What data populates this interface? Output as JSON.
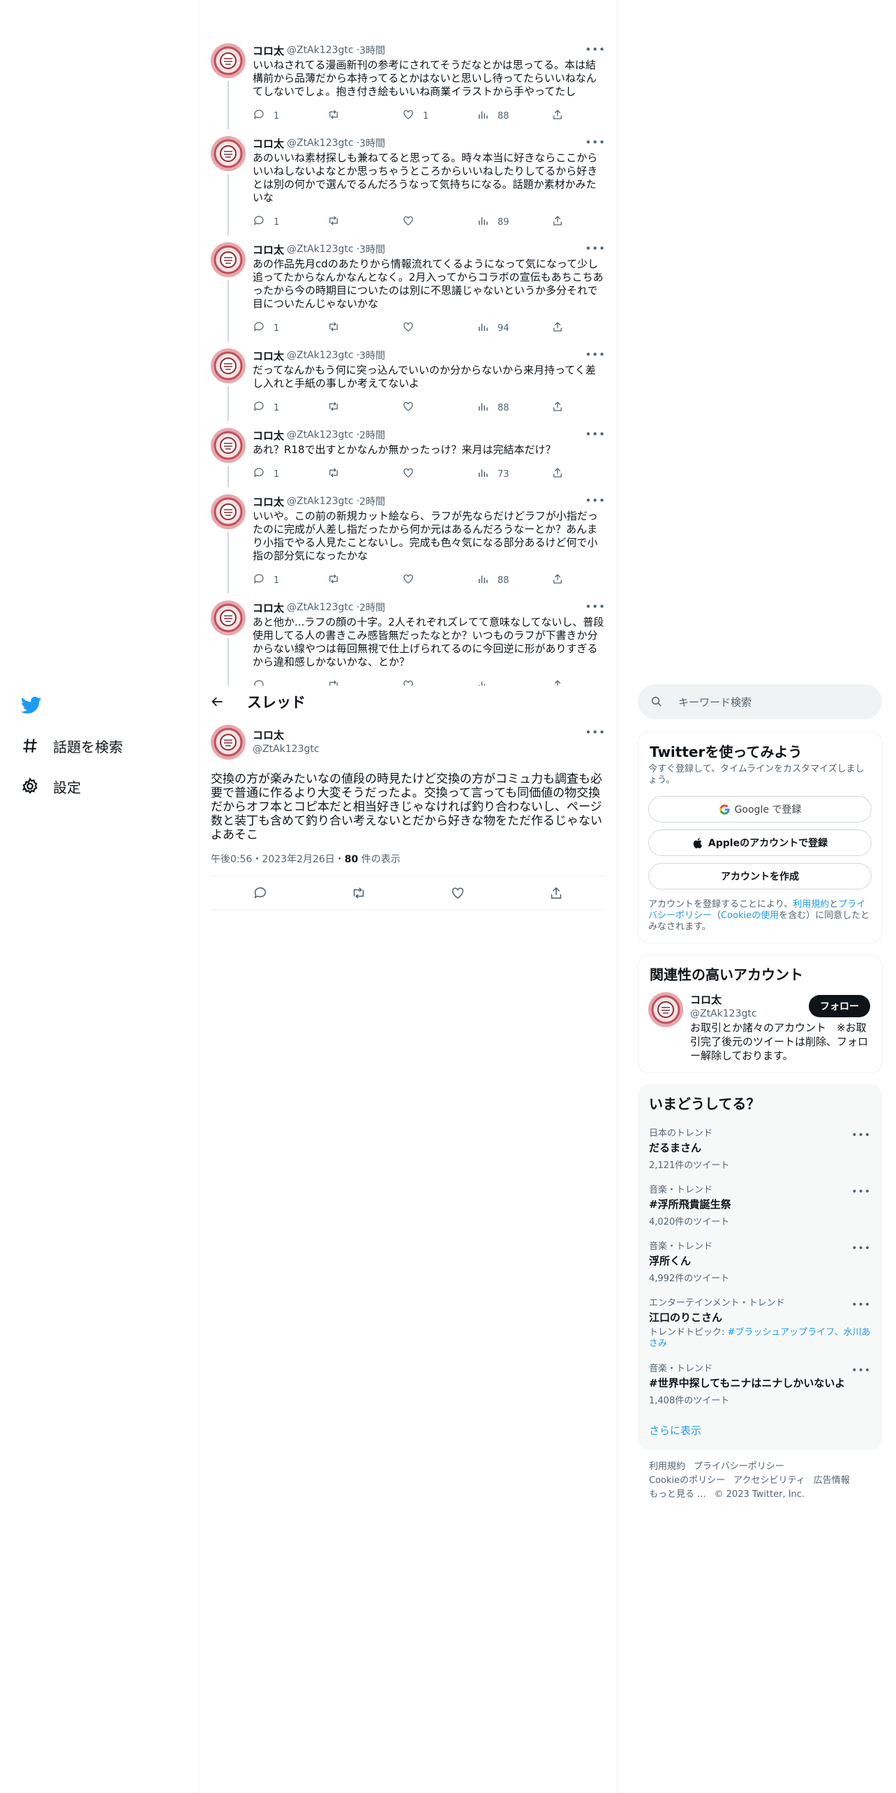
{
  "thread": [
    {
      "name": "コロ太",
      "handle": "@ZtAk123gtc",
      "time": "3時間",
      "text": "いいねされてる漫画新刊の参考にされてそうだなとかは思ってる。本は結構前から品薄だから本持ってるとかはないと思いし待ってたらいいねなんてしないでしょ。抱き付き絵もいいね商業イラストから手やってたし",
      "reply": "1",
      "retweet": "",
      "like": "1",
      "views": "88"
    },
    {
      "name": "コロ太",
      "handle": "@ZtAk123gtc",
      "time": "3時間",
      "text": "あのいいね素材探しも兼ねてると思ってる。時々本当に好きならここからいいねしないよなとか思っちゃうところからいいねしたりしてるから好きとは別の何かで選んでるんだろうなって気持ちになる。話題か素材かみたいな",
      "reply": "1",
      "retweet": "",
      "like": "",
      "views": "89"
    },
    {
      "name": "コロ太",
      "handle": "@ZtAk123gtc",
      "time": "3時間",
      "text": "あの作品先月cdのあたりから情報流れてくるようになって気になって少し追ってたからなんかなんとなく。2月入ってからコラボの宣伝もあちこちあったから今の時期目についたのは別に不思議じゃないというか多分それで目についたんじゃないかな",
      "reply": "1",
      "retweet": "",
      "like": "",
      "views": "94"
    },
    {
      "name": "コロ太",
      "handle": "@ZtAk123gtc",
      "time": "3時間",
      "text": "だってなんかもう何に突っ込んでいいのか分からないから来月持ってく差し入れと手紙の事しか考えてないよ",
      "reply": "1",
      "retweet": "",
      "like": "",
      "views": "88"
    },
    {
      "name": "コロ太",
      "handle": "@ZtAk123gtc",
      "time": "2時間",
      "text": "あれ？R18で出すとかなんか無かったっけ？来月は完結本だけ？",
      "reply": "1",
      "retweet": "",
      "like": "",
      "views": "73"
    },
    {
      "name": "コロ太",
      "handle": "@ZtAk123gtc",
      "time": "2時間",
      "text": "いいや。この前の新規カット絵なら、ラフが先ならだけどラフが小指だったのに完成が人差し指だったから何か元はあるんだろうなーとか？あんまり小指でやる人見たことないし。完成も色々気になる部分あるけど何で小指の部分気になったかな",
      "reply": "1",
      "retweet": "",
      "like": "",
      "views": "88"
    },
    {
      "name": "コロ太",
      "handle": "@ZtAk123gtc",
      "time": "2時間",
      "text": "あと他か...ラフの顔の十字。2人それぞれズレてて意味なしてないし、普段使用してる人の書きこみ感皆無だったなとか？いつものラフが下書きか分からない線やつは毎回無視で仕上げられてるのに今回逆に形がありすぎるから違和感しかないかな、とか？",
      "reply": "",
      "retweet": "",
      "like": "",
      "views": ""
    }
  ],
  "nav": {
    "explore": "話題を検索",
    "settings": "設定"
  },
  "header": {
    "title": "スレッド"
  },
  "main_tweet": {
    "name": "コロ太",
    "handle": "@ZtAk123gtc",
    "text": "交換の方が楽みたいなの値段の時見たけど交換の方がコミュ力も調査も必要で普通に作るより大変そうだったよ。交換って言っても同価値の物交換だからオフ本とコピ本だと相当好きじゃなければ釣り合わないし、ページ数と装丁も含めて釣り合い考えないとだから好きな物をただ作るじゃないよあそこ",
    "time": "午後0:56・2023年2月26日・",
    "views": "80",
    "views_suffix": " 件の表示"
  },
  "right": {
    "search_placeholder": "キーワード検索",
    "signup": {
      "title": "Twitterを使ってみよう",
      "sub": "今すぐ登録して、タイムラインをカスタマイズしましょう。",
      "google": "Google で登録",
      "apple": "Appleのアカウントで登録",
      "create": "アカウントを作成",
      "legal_1": "アカウントを登録することにより、",
      "terms": "利用規約",
      "and": "と",
      "privacy": "プライバシーポリシー",
      "paren_open": "（",
      "cookie": "Cookieの使用",
      "legal_2": "を含む）に同意したとみなされます。"
    },
    "related": {
      "title": "関連性の高いアカウント",
      "name": "コロ太",
      "handle": "@ZtAk123gtc",
      "follow": "フォロー",
      "bio": "お取引とか諸々のアカウント　※お取引完了後元のツイートは削除、フォロー解除しております。"
    },
    "trends": {
      "title": "いまどうしてる？",
      "items": [
        {
          "cat": "日本のトレンド",
          "name": "だるまさん",
          "count": "2,121件のツイート"
        },
        {
          "cat": "音楽・トレンド",
          "name": "#浮所飛貴誕生祭",
          "count": "4,020件のツイート"
        },
        {
          "cat": "音楽・トレンド",
          "name": "浮所くん",
          "count": "4,992件のツイート"
        },
        {
          "cat": "エンターテインメント・トレンド",
          "name": "江口のりこさん",
          "topic_label": "トレンドトピック: ",
          "topic_links": "#ブラッシュアップライフ、水川あさみ"
        },
        {
          "cat": "音楽・トレンド",
          "name": "#世界中探してもニナはニナしかいないよ",
          "count": "1,408件のツイート"
        }
      ],
      "show_more": "さらに表示"
    },
    "footer": [
      "利用規約",
      "プライバシーポリシー",
      "Cookieのポリシー",
      "アクセシビリティ",
      "広告情報",
      "もっと見る ...",
      "© 2023 Twitter, Inc."
    ]
  }
}
